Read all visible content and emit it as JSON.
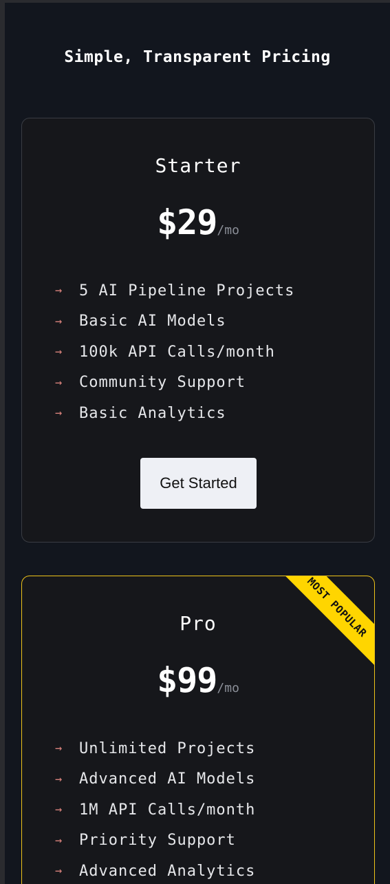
{
  "page": {
    "title": "Simple, Transparent Pricing"
  },
  "plans": [
    {
      "name": "Starter",
      "price": "$29",
      "period": "/mo",
      "features": [
        "5 AI Pipeline Projects",
        "Basic AI Models",
        "100k API Calls/month",
        "Community Support",
        "Basic Analytics"
      ],
      "cta": "Get Started",
      "feature_icon": "arrow-right-icon"
    },
    {
      "name": "Pro",
      "price": "$99",
      "period": "/mo",
      "badge": "MOST POPULAR",
      "features": [
        "Unlimited Projects",
        "Advanced AI Models",
        "1M API Calls/month",
        "Priority Support",
        "Advanced Analytics"
      ],
      "feature_icon": "arrow-right-icon"
    }
  ],
  "colors": {
    "background": "#12161e",
    "card": "#16171b",
    "accent": "#ffd500",
    "arrow": "#d9827c"
  },
  "arrow_glyph": "→"
}
